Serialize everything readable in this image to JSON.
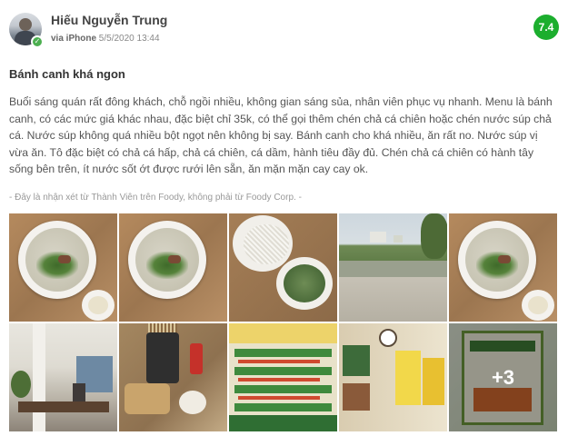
{
  "review": {
    "user_name": "Hiếu Nguyễn Trung",
    "via_label": "via iPhone",
    "timestamp": "5/5/2020 13:44",
    "score": "7.4",
    "title": "Bánh canh khá ngon",
    "body": "Buổi sáng quán rất đông khách, chỗ ngồi nhiều, không gian sáng sủa, nhân viên phục vụ nhanh. Menu là bánh canh, có các mức giá khác nhau, đặc biệt chỉ 35k, có thể gọi thêm chén chả cá chiên hoặc chén nước súp chả cá. Nước súp không quá nhiều bột ngọt nên không bị say. Bánh canh cho khá nhiều, ăn rất no. Nước súp vị vừa ăn. Tô đặc biệt có chả cá hấp, chả cá chiên, cá dầm, hành tiêu đầy đủ. Chén chả cá chiên có hành tây sống bên trên, ít nước sốt ớt được rưới lên sẵn, ăn mặn mặn cay cay ok.",
    "disclaimer": "- Đây là nhận xét từ Thành Viên trên Foody, không phải từ Foody Corp. -"
  },
  "gallery": {
    "more_count": "+3"
  },
  "colors": {
    "score_badge": "#1cae2e",
    "verified_badge": "#4caf50"
  }
}
